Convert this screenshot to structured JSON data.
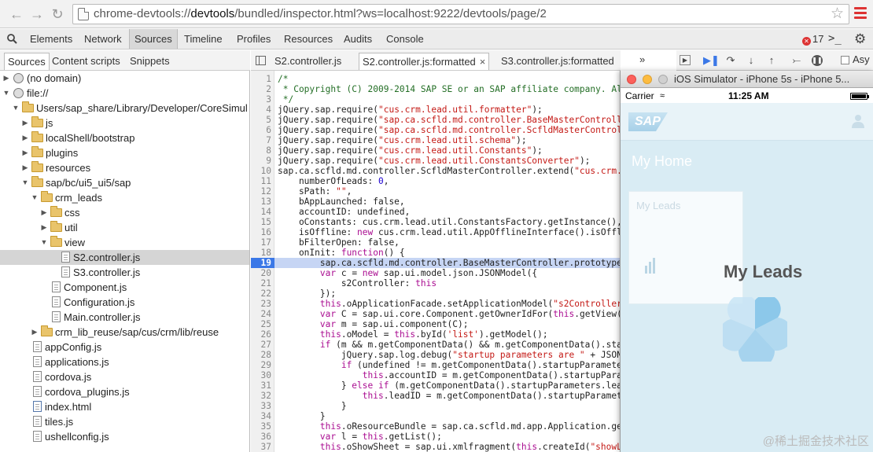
{
  "browser": {
    "url_prefix": "chrome-devtools://",
    "url_host": "devtools",
    "url_path": "/bundled/inspector.html?ws=localhost:9222/devtools/page/2"
  },
  "devtools_tabs": [
    "Elements",
    "Network",
    "Sources",
    "Timeline",
    "Profiles",
    "Resources",
    "Audits",
    "Console"
  ],
  "active_devtools_tab": "Sources",
  "error_count": "17",
  "sources_subtabs": [
    "Sources",
    "Content scripts",
    "Snippets"
  ],
  "tree": [
    {
      "label": "(no domain)"
    },
    {
      "label": "file://"
    },
    {
      "label": "Users/sap_share/Library/Developer/CoreSimul"
    },
    {
      "label": "js"
    },
    {
      "label": "localShell/bootstrap"
    },
    {
      "label": "plugins"
    },
    {
      "label": "resources"
    },
    {
      "label": "sap/bc/ui5_ui5/sap"
    },
    {
      "label": "crm_leads"
    },
    {
      "label": "css"
    },
    {
      "label": "util"
    },
    {
      "label": "view"
    },
    {
      "label": "S2.controller.js"
    },
    {
      "label": "S3.controller.js"
    },
    {
      "label": "Component.js"
    },
    {
      "label": "Configuration.js"
    },
    {
      "label": "Main.controller.js"
    },
    {
      "label": "crm_lib_reuse/sap/cus/crm/lib/reuse"
    },
    {
      "label": "appConfig.js"
    },
    {
      "label": "applications.js"
    },
    {
      "label": "cordova.js"
    },
    {
      "label": "cordova_plugins.js"
    },
    {
      "label": "index.html"
    },
    {
      "label": "tiles.js"
    },
    {
      "label": "ushellconfig.js"
    }
  ],
  "editor_tabs": [
    {
      "label": "S2.controller.js"
    },
    {
      "label": "S2.controller.js:formatted",
      "close": "×"
    },
    {
      "label": "S3.controller.js:formatted"
    }
  ],
  "editor_more": "»",
  "code_lines": [
    {
      "n": "1",
      "t": "/*"
    },
    {
      "n": "2",
      "t": " * Copyright (C) 2009-2014 SAP SE or an SAP affiliate company. All"
    },
    {
      "n": "3",
      "t": " */"
    },
    {
      "n": "4",
      "t": "jQuery.sap.require(\"cus.crm.lead.util.formatter\");"
    },
    {
      "n": "5",
      "t": "jQuery.sap.require(\"sap.ca.scfld.md.controller.BaseMasterControlle"
    },
    {
      "n": "6",
      "t": "jQuery.sap.require(\"sap.ca.scfld.md.controller.ScfldMasterControll"
    },
    {
      "n": "7",
      "t": "jQuery.sap.require(\"cus.crm.lead.util.schema\");"
    },
    {
      "n": "8",
      "t": "jQuery.sap.require(\"cus.crm.lead.util.Constants\");"
    },
    {
      "n": "9",
      "t": "jQuery.sap.require(\"cus.crm.lead.util.ConstantsConverter\");"
    },
    {
      "n": "10",
      "t": "sap.ca.scfld.md.controller.ScfldMasterController.extend(\"cus.crm.l"
    },
    {
      "n": "11",
      "t": "    numberOfLeads: 0,"
    },
    {
      "n": "12",
      "t": "    sPath: \"\","
    },
    {
      "n": "13",
      "t": "    bAppLaunched: false,"
    },
    {
      "n": "14",
      "t": "    accountID: undefined,"
    },
    {
      "n": "15",
      "t": "    oConstants: cus.crm.lead.util.ConstantsFactory.getInstance(),"
    },
    {
      "n": "16",
      "t": "    isOffline: new cus.crm.lead.util.AppOfflineInterface().isOffli"
    },
    {
      "n": "17",
      "t": "    bFilterOpen: false,"
    },
    {
      "n": "18",
      "t": "    onInit: function() {"
    },
    {
      "n": "19",
      "t": "        sap.ca.scfld.md.controller.BaseMasterController.prototype."
    },
    {
      "n": "20",
      "t": "        var c = new sap.ui.model.json.JSONModel({"
    },
    {
      "n": "21",
      "t": "            s2Controller: this"
    },
    {
      "n": "22",
      "t": "        });"
    },
    {
      "n": "23",
      "t": "        this.oApplicationFacade.setApplicationModel(\"s2Controller\""
    },
    {
      "n": "24",
      "t": "        var C = sap.ui.core.Component.getOwnerIdFor(this.getView()"
    },
    {
      "n": "25",
      "t": "        var m = sap.ui.component(C);"
    },
    {
      "n": "26",
      "t": "        this.oModel = this.byId('list').getModel();"
    },
    {
      "n": "27",
      "t": "        if (m && m.getComponentData() && m.getComponentData().star"
    },
    {
      "n": "28",
      "t": "            jQuery.sap.log.debug(\"startup parameters are \" + JSON."
    },
    {
      "n": "29",
      "t": "            if (undefined != m.getComponentData().startupParameter"
    },
    {
      "n": "30",
      "t": "                this.accountID = m.getComponentData().startupParam"
    },
    {
      "n": "31",
      "t": "            } else if (m.getComponentData().startupParameters.lead"
    },
    {
      "n": "32",
      "t": "                this.leadID = m.getComponentData().startupParamete"
    },
    {
      "n": "33",
      "t": "            }"
    },
    {
      "n": "34",
      "t": "        }"
    },
    {
      "n": "35",
      "t": "        this.oResourceBundle = sap.ca.scfld.md.app.Application.get"
    },
    {
      "n": "36",
      "t": "        var l = this.getList();"
    },
    {
      "n": "37",
      "t": "        this.oShowSheet = sap.ui.xmlfragment(this.createId(\"showLe"
    }
  ],
  "highlight_line": "19",
  "simulator": {
    "title": "iOS Simulator - iPhone 5s - iPhone 5...",
    "carrier": "Carrier",
    "time": "11:25 AM",
    "logo": "SAP",
    "home_title": "My Home",
    "tile_title": "My Leads",
    "busy_title": "My Leads"
  },
  "debugger_partial": "Asy",
  "watermark": "@稀土掘金技术社区",
  "colors": {
    "accent": "#3b78e7",
    "error": "#dd3333",
    "folder": "#e9c46b"
  }
}
